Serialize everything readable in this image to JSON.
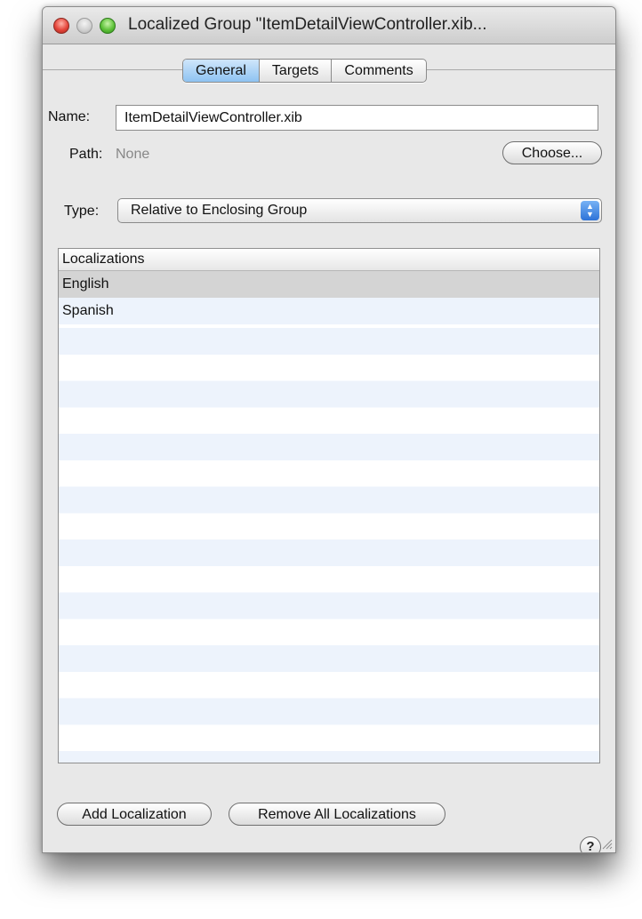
{
  "window": {
    "title": "Localized Group \"ItemDetailViewController.xib..."
  },
  "tabs": [
    {
      "label": "General",
      "selected": true
    },
    {
      "label": "Targets",
      "selected": false
    },
    {
      "label": "Comments",
      "selected": false
    }
  ],
  "form": {
    "name_label": "Name:",
    "name_value": "ItemDetailViewController.xib",
    "path_label": "Path:",
    "path_value": "None",
    "choose_button": "Choose...",
    "type_label": "Type:",
    "type_value": "Relative to Enclosing Group"
  },
  "localizations": {
    "header": "Localizations",
    "rows": [
      "English",
      "Spanish"
    ]
  },
  "buttons": {
    "add": "Add Localization",
    "remove_all": "Remove All Localizations",
    "help": "?"
  },
  "colors": {
    "selected_tab": "#8ec3f2",
    "popup_arrows": "#2d73d8",
    "selected_row": "#d4d4d4",
    "alt_row": "#edf3fc"
  }
}
